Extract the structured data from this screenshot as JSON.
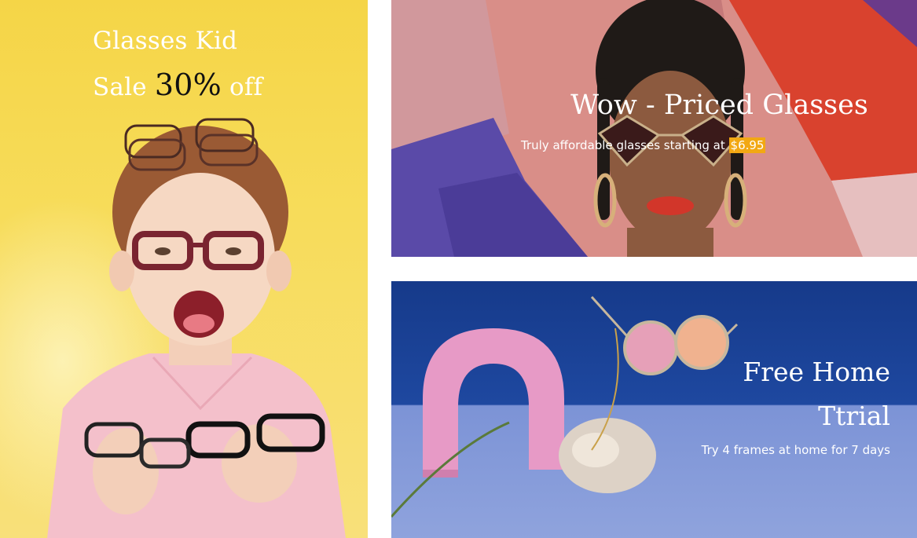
{
  "banners": {
    "kids": {
      "line1": "Glasses Kid",
      "line2_prefix": "Sale",
      "line2_highlight": "30%",
      "line2_suffix": "off"
    },
    "priced": {
      "headline": "Wow - Priced Glasses",
      "sub_prefix": "Truly affordable glasses starting at",
      "price": "$6.95"
    },
    "trial": {
      "headline_line1": "Free Home",
      "headline_line2": "Ttrial",
      "sub": "Try 4 frames at home for 7 days"
    }
  },
  "colors": {
    "kids_bg": "#f5d547",
    "priced_bg": "#d78b86",
    "price_highlight": "#f2a813",
    "trial_bg": "#1e48a0",
    "trial_floor": "#8fa3dd"
  }
}
